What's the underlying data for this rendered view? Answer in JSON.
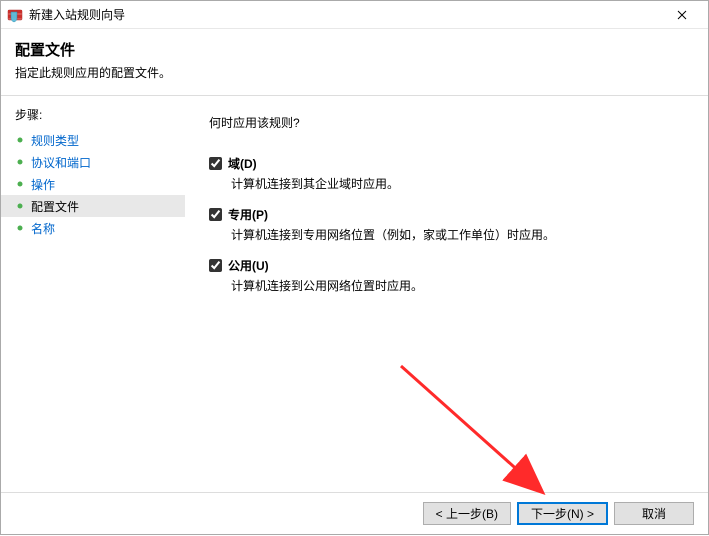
{
  "window": {
    "title": "新建入站规则向导"
  },
  "header": {
    "title": "配置文件",
    "subtitle": "指定此规则应用的配置文件。"
  },
  "sidebar": {
    "steps_label": "步骤:",
    "items": [
      {
        "label": "规则类型",
        "current": false
      },
      {
        "label": "协议和端口",
        "current": false
      },
      {
        "label": "操作",
        "current": false
      },
      {
        "label": "配置文件",
        "current": true
      },
      {
        "label": "名称",
        "current": false
      }
    ]
  },
  "content": {
    "question": "何时应用该规则?",
    "options": [
      {
        "label": "域(D)",
        "desc": "计算机连接到其企业域时应用。",
        "checked": true
      },
      {
        "label": "专用(P)",
        "desc": "计算机连接到专用网络位置（例如，家或工作单位）时应用。",
        "checked": true
      },
      {
        "label": "公用(U)",
        "desc": "计算机连接到公用网络位置时应用。",
        "checked": true
      }
    ]
  },
  "footer": {
    "back": "< 上一步(B)",
    "next": "下一步(N) >",
    "cancel": "取消"
  }
}
